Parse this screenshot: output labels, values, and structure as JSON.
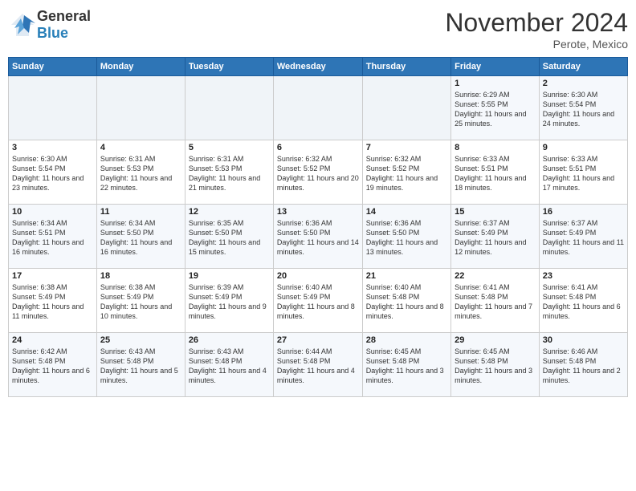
{
  "header": {
    "logo": {
      "general": "General",
      "blue": "Blue"
    },
    "title": "November 2024",
    "location": "Perote, Mexico"
  },
  "weekdays": [
    "Sunday",
    "Monday",
    "Tuesday",
    "Wednesday",
    "Thursday",
    "Friday",
    "Saturday"
  ],
  "weeks": [
    [
      {
        "day": "",
        "info": ""
      },
      {
        "day": "",
        "info": ""
      },
      {
        "day": "",
        "info": ""
      },
      {
        "day": "",
        "info": ""
      },
      {
        "day": "",
        "info": ""
      },
      {
        "day": "1",
        "info": "Sunrise: 6:29 AM\nSunset: 5:55 PM\nDaylight: 11 hours and 25 minutes."
      },
      {
        "day": "2",
        "info": "Sunrise: 6:30 AM\nSunset: 5:54 PM\nDaylight: 11 hours and 24 minutes."
      }
    ],
    [
      {
        "day": "3",
        "info": "Sunrise: 6:30 AM\nSunset: 5:54 PM\nDaylight: 11 hours and 23 minutes."
      },
      {
        "day": "4",
        "info": "Sunrise: 6:31 AM\nSunset: 5:53 PM\nDaylight: 11 hours and 22 minutes."
      },
      {
        "day": "5",
        "info": "Sunrise: 6:31 AM\nSunset: 5:53 PM\nDaylight: 11 hours and 21 minutes."
      },
      {
        "day": "6",
        "info": "Sunrise: 6:32 AM\nSunset: 5:52 PM\nDaylight: 11 hours and 20 minutes."
      },
      {
        "day": "7",
        "info": "Sunrise: 6:32 AM\nSunset: 5:52 PM\nDaylight: 11 hours and 19 minutes."
      },
      {
        "day": "8",
        "info": "Sunrise: 6:33 AM\nSunset: 5:51 PM\nDaylight: 11 hours and 18 minutes."
      },
      {
        "day": "9",
        "info": "Sunrise: 6:33 AM\nSunset: 5:51 PM\nDaylight: 11 hours and 17 minutes."
      }
    ],
    [
      {
        "day": "10",
        "info": "Sunrise: 6:34 AM\nSunset: 5:51 PM\nDaylight: 11 hours and 16 minutes."
      },
      {
        "day": "11",
        "info": "Sunrise: 6:34 AM\nSunset: 5:50 PM\nDaylight: 11 hours and 16 minutes."
      },
      {
        "day": "12",
        "info": "Sunrise: 6:35 AM\nSunset: 5:50 PM\nDaylight: 11 hours and 15 minutes."
      },
      {
        "day": "13",
        "info": "Sunrise: 6:36 AM\nSunset: 5:50 PM\nDaylight: 11 hours and 14 minutes."
      },
      {
        "day": "14",
        "info": "Sunrise: 6:36 AM\nSunset: 5:50 PM\nDaylight: 11 hours and 13 minutes."
      },
      {
        "day": "15",
        "info": "Sunrise: 6:37 AM\nSunset: 5:49 PM\nDaylight: 11 hours and 12 minutes."
      },
      {
        "day": "16",
        "info": "Sunrise: 6:37 AM\nSunset: 5:49 PM\nDaylight: 11 hours and 11 minutes."
      }
    ],
    [
      {
        "day": "17",
        "info": "Sunrise: 6:38 AM\nSunset: 5:49 PM\nDaylight: 11 hours and 11 minutes."
      },
      {
        "day": "18",
        "info": "Sunrise: 6:38 AM\nSunset: 5:49 PM\nDaylight: 11 hours and 10 minutes."
      },
      {
        "day": "19",
        "info": "Sunrise: 6:39 AM\nSunset: 5:49 PM\nDaylight: 11 hours and 9 minutes."
      },
      {
        "day": "20",
        "info": "Sunrise: 6:40 AM\nSunset: 5:49 PM\nDaylight: 11 hours and 8 minutes."
      },
      {
        "day": "21",
        "info": "Sunrise: 6:40 AM\nSunset: 5:48 PM\nDaylight: 11 hours and 8 minutes."
      },
      {
        "day": "22",
        "info": "Sunrise: 6:41 AM\nSunset: 5:48 PM\nDaylight: 11 hours and 7 minutes."
      },
      {
        "day": "23",
        "info": "Sunrise: 6:41 AM\nSunset: 5:48 PM\nDaylight: 11 hours and 6 minutes."
      }
    ],
    [
      {
        "day": "24",
        "info": "Sunrise: 6:42 AM\nSunset: 5:48 PM\nDaylight: 11 hours and 6 minutes."
      },
      {
        "day": "25",
        "info": "Sunrise: 6:43 AM\nSunset: 5:48 PM\nDaylight: 11 hours and 5 minutes."
      },
      {
        "day": "26",
        "info": "Sunrise: 6:43 AM\nSunset: 5:48 PM\nDaylight: 11 hours and 4 minutes."
      },
      {
        "day": "27",
        "info": "Sunrise: 6:44 AM\nSunset: 5:48 PM\nDaylight: 11 hours and 4 minutes."
      },
      {
        "day": "28",
        "info": "Sunrise: 6:45 AM\nSunset: 5:48 PM\nDaylight: 11 hours and 3 minutes."
      },
      {
        "day": "29",
        "info": "Sunrise: 6:45 AM\nSunset: 5:48 PM\nDaylight: 11 hours and 3 minutes."
      },
      {
        "day": "30",
        "info": "Sunrise: 6:46 AM\nSunset: 5:48 PM\nDaylight: 11 hours and 2 minutes."
      }
    ]
  ]
}
